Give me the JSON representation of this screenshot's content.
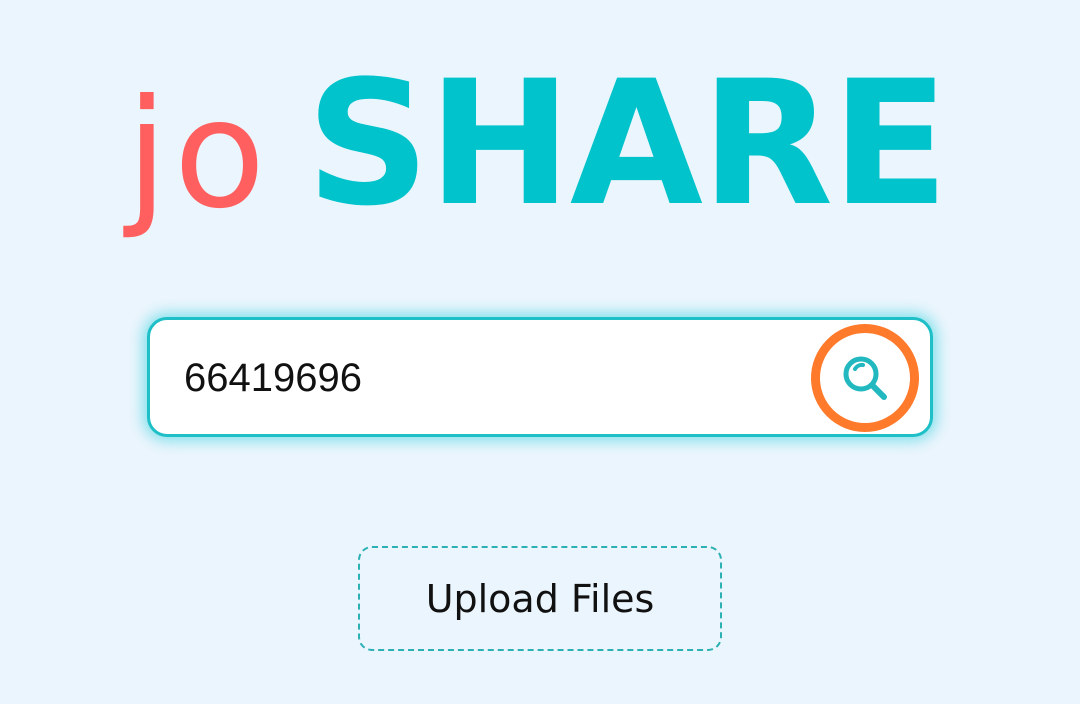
{
  "logo": {
    "prefix": "jo",
    "main": "SHARE"
  },
  "search": {
    "value": "66419696",
    "button_icon": "search-icon"
  },
  "upload": {
    "label": "Upload Files"
  },
  "colors": {
    "background": "#ebf5fd",
    "logo_prefix": "#ff5f5f",
    "logo_main": "#00c3cb",
    "search_border": "#1fbfc7",
    "search_button_ring": "#ff7a2a",
    "upload_border": "#2bb0b3"
  }
}
